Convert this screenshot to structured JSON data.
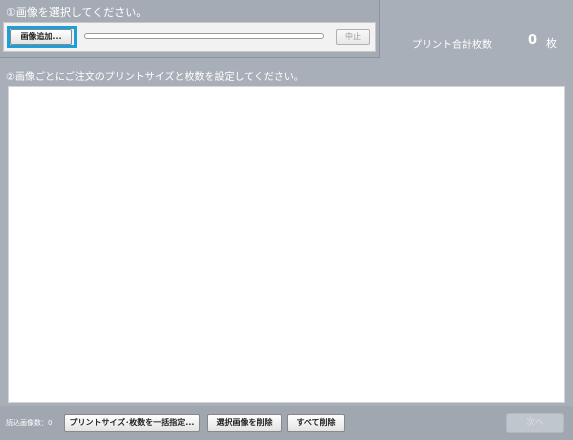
{
  "step1": {
    "heading": "①画像を選択してください。",
    "add_button": "画像追加...",
    "cancel_button": "中止",
    "upload_progress": 0
  },
  "totals": {
    "label": "プリント合計枚数",
    "count": "0",
    "unit": "枚"
  },
  "step2": {
    "heading": "②画像ごとにご注文のプリントサイズと枚数を設定してください。",
    "images": []
  },
  "footer": {
    "loaded_count_label": "読込画像数：0",
    "bulk_set_button": "プリントサイズ･枚数を一括指定...",
    "delete_selected_button": "選択画像を削除",
    "delete_all_button": "すべて削除",
    "next_button": "次へ"
  },
  "colors": {
    "background": "#a8afb8",
    "highlight": "#1f9fd8"
  }
}
